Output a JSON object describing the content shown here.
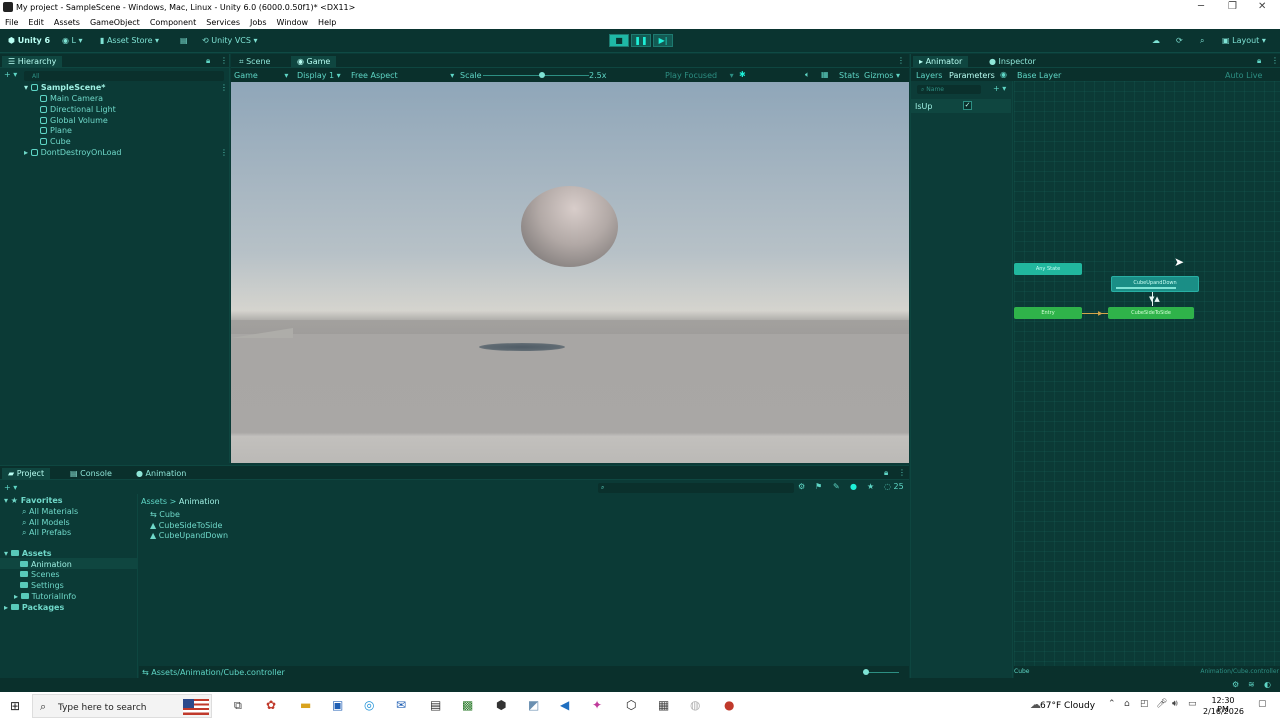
{
  "window": {
    "title": "My project - SampleScene - Windows, Mac, Linux - Unity 6.0 (6000.0.50f1)* <DX11>",
    "menu": [
      "File",
      "Edit",
      "Assets",
      "GameObject",
      "Component",
      "Services",
      "Jobs",
      "Window",
      "Help"
    ]
  },
  "toolbar": {
    "unity_label": "Unity 6",
    "account_label": "L",
    "asset_store_label": "Asset Store",
    "vcs_label": "Unity VCS",
    "layout_label": "Layout"
  },
  "hierarchy": {
    "tab": "Hierarchy",
    "search_placeholder": "All",
    "scene": "SampleScene*",
    "items": [
      "Main Camera",
      "Directional Light",
      "Global Volume",
      "Plane",
      "Cube"
    ],
    "dont_destroy": "DontDestroyOnLoad"
  },
  "game_panel": {
    "tabs": [
      "Scene",
      "Game"
    ],
    "mode": "Game",
    "display": "Display 1",
    "aspect": "Free Aspect",
    "scale_label": "Scale",
    "scale_value": "2.5x",
    "play_focused": "Play Focused",
    "stats": "Stats",
    "gizmos": "Gizmos"
  },
  "animator": {
    "tabs": [
      "Animator",
      "Inspector"
    ],
    "subtabs": [
      "Layers",
      "Parameters"
    ],
    "base_layer": "Base Layer",
    "auto_live_link": "Auto Live Link",
    "search_placeholder": "Name",
    "param_name": "IsUp",
    "nodes": {
      "any_state": "Any State",
      "entry": "Entry",
      "cube_up_down": "CubeUpandDown",
      "cube_side": "CubeSideToSide"
    },
    "footer_left": "Cube",
    "footer_right": "Animation/Cube.controller"
  },
  "project": {
    "tabs": [
      "Project",
      "Console",
      "Animation"
    ],
    "favorites_label": "Favorites",
    "favorites": [
      "All Materials",
      "All Models",
      "All Prefabs"
    ],
    "assets_label": "Assets",
    "asset_folders": [
      "Animation",
      "Scenes",
      "Settings",
      "TutorialInfo"
    ],
    "packages_label": "Packages",
    "breadcrumb": [
      "Assets",
      "Animation"
    ],
    "files": [
      "Cube",
      "CubeSideToSide",
      "CubeUpandDown"
    ],
    "path": "Assets/Animation/Cube.controller",
    "count": "25"
  },
  "taskbar": {
    "search_placeholder": "Type here to search",
    "weather": "67°F  Cloudy",
    "time": "12:30 PM",
    "date": "2/16/2026"
  },
  "colors": {
    "panel": "#0b3a36",
    "accent": "#1ef0d8",
    "entry_node": "#2fb34a",
    "anystate_node": "#21b79e",
    "active_node": "#1a8e86"
  }
}
